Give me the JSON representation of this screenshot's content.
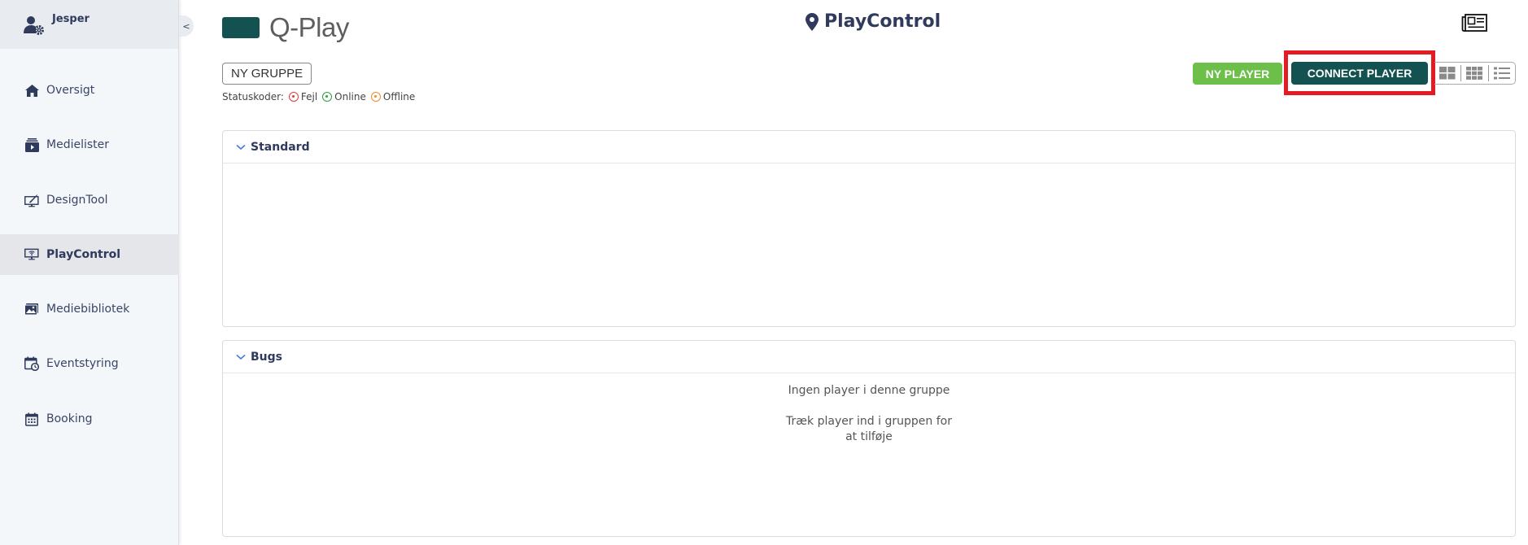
{
  "sidebar": {
    "user": {
      "name": "Jesper",
      "icon": "user-gear-icon"
    },
    "collapse_label": "<",
    "items": [
      {
        "label": "Oversigt",
        "icon": "home-icon",
        "active": false
      },
      {
        "label": "Medielister",
        "icon": "media-list-icon",
        "active": false
      },
      {
        "label": "DesignTool",
        "icon": "design-tool-icon",
        "active": false
      },
      {
        "label": "PlayControl",
        "icon": "screen-wifi-icon",
        "active": true
      },
      {
        "label": "Mediebibliotek",
        "icon": "image-library-icon",
        "active": false
      },
      {
        "label": "Eventstyring",
        "icon": "calendar-clock-icon",
        "active": false
      },
      {
        "label": "Booking",
        "icon": "calendar-icon",
        "active": false
      }
    ]
  },
  "header": {
    "logo_text": "Q-Play",
    "page_title": "PlayControl",
    "page_icon": "map-pin-icon",
    "right_icon": "newspaper-icon"
  },
  "toolbar": {
    "new_group_label": "NY GRUPPE",
    "status_label": "Statuskoder:",
    "statuses": [
      {
        "label": "Fejl",
        "color": "#e53935"
      },
      {
        "label": "Online",
        "color": "#2e9e3e"
      },
      {
        "label": "Offline",
        "color": "#f08a24"
      }
    ],
    "new_player_label": "NY PLAYER",
    "connect_player_label": "CONNECT PLAYER",
    "view_modes": [
      "large-grid-icon",
      "small-grid-icon",
      "list-icon"
    ]
  },
  "groups": [
    {
      "title": "Standard",
      "empty_message": "",
      "empty_hint": ""
    },
    {
      "title": "Bugs",
      "empty_message": "Ingen player i denne gruppe",
      "empty_hint_line1": "Træk player ind i gruppen for",
      "empty_hint_line2": "at tilføje"
    }
  ],
  "colors": {
    "brand": "#135250",
    "new_player": "#6cc04a",
    "highlight": "#e51b23",
    "nav_text": "#3a4466"
  }
}
